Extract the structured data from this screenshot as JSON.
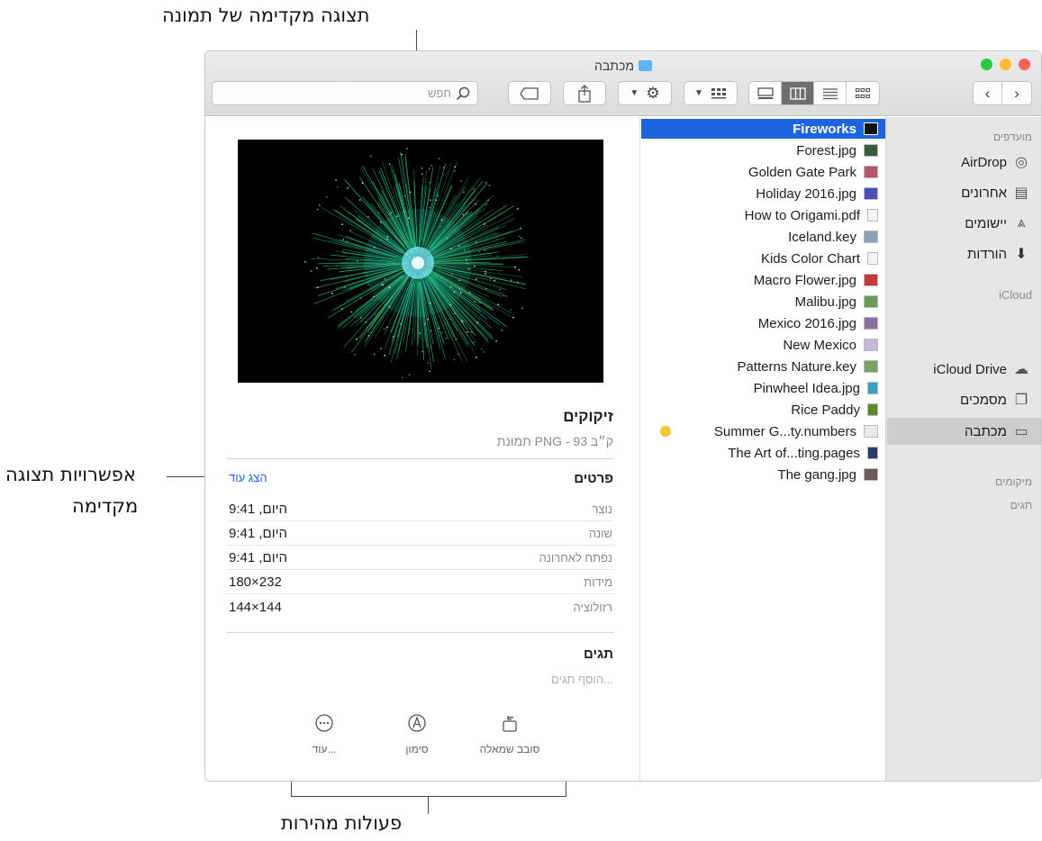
{
  "callouts": {
    "top": "תצוגה מקדימה של תמונה",
    "preview_options_1": "אפשרויות תצוגה",
    "preview_options_2": "מקדימה",
    "quick_actions": "פעולות מהירות"
  },
  "window": {
    "title": "מכתבה",
    "search_placeholder": "חפש"
  },
  "sidebar": {
    "favorites_label": "מועדפים",
    "favorites": [
      {
        "label": "AirDrop",
        "icon": "airdrop-icon"
      },
      {
        "label": "אחרונים",
        "icon": "recents-icon"
      },
      {
        "label": "יישומים",
        "icon": "applications-icon"
      },
      {
        "label": "הורדות",
        "icon": "downloads-icon"
      }
    ],
    "icloud_label": "iCloud",
    "icloud": [
      {
        "label": "iCloud Drive",
        "icon": "cloud-icon"
      },
      {
        "label": "מסמכים",
        "icon": "documents-icon"
      },
      {
        "label": "מכתבה",
        "icon": "desktop-icon"
      }
    ],
    "locations_label": "מיקומים",
    "tags_label": "תגים"
  },
  "files": [
    {
      "name": "Fireworks",
      "selected": true
    },
    {
      "name": "Forest.jpg"
    },
    {
      "name": "Golden Gate Park"
    },
    {
      "name": "Holiday 2016.jpg"
    },
    {
      "name": "How to Origami.pdf"
    },
    {
      "name": "Iceland.key"
    },
    {
      "name": "Kids Color Chart"
    },
    {
      "name": "Macro Flower.jpg"
    },
    {
      "name": "Malibu.jpg"
    },
    {
      "name": "Mexico 2016.jpg"
    },
    {
      "name": "New Mexico"
    },
    {
      "name": "Patterns Nature.key"
    },
    {
      "name": "Pinwheel Idea.jpg"
    },
    {
      "name": "Rice Paddy"
    },
    {
      "name": "Summer G...ty.numbers",
      "tag_color": "#f7c52f"
    },
    {
      "name": "The Art of...ting.pages"
    },
    {
      "name": "The gang.jpg"
    }
  ],
  "preview": {
    "name": "זיקוקים",
    "description": "תמונת PNG - 93 ק״ב",
    "details_title": "פרטים",
    "show_more": "הצג עוד",
    "details": [
      {
        "label": "נוצר",
        "value": "היום, 9:41"
      },
      {
        "label": "שונה",
        "value": "היום, 9:41"
      },
      {
        "label": "נפתח לאחרונה",
        "value": "היום, 9:41"
      },
      {
        "label": "מידות",
        "value": "180×232"
      },
      {
        "label": "רזולוציה",
        "value": "144×144"
      }
    ],
    "tags_title": "תגים",
    "tags_placeholder": "הוסף תגים...",
    "actions": [
      {
        "label": "סובב שמאלה",
        "icon": "rotate-left-icon"
      },
      {
        "label": "סימון",
        "icon": "markup-icon"
      },
      {
        "label": "עוד...",
        "icon": "more-icon"
      }
    ]
  }
}
